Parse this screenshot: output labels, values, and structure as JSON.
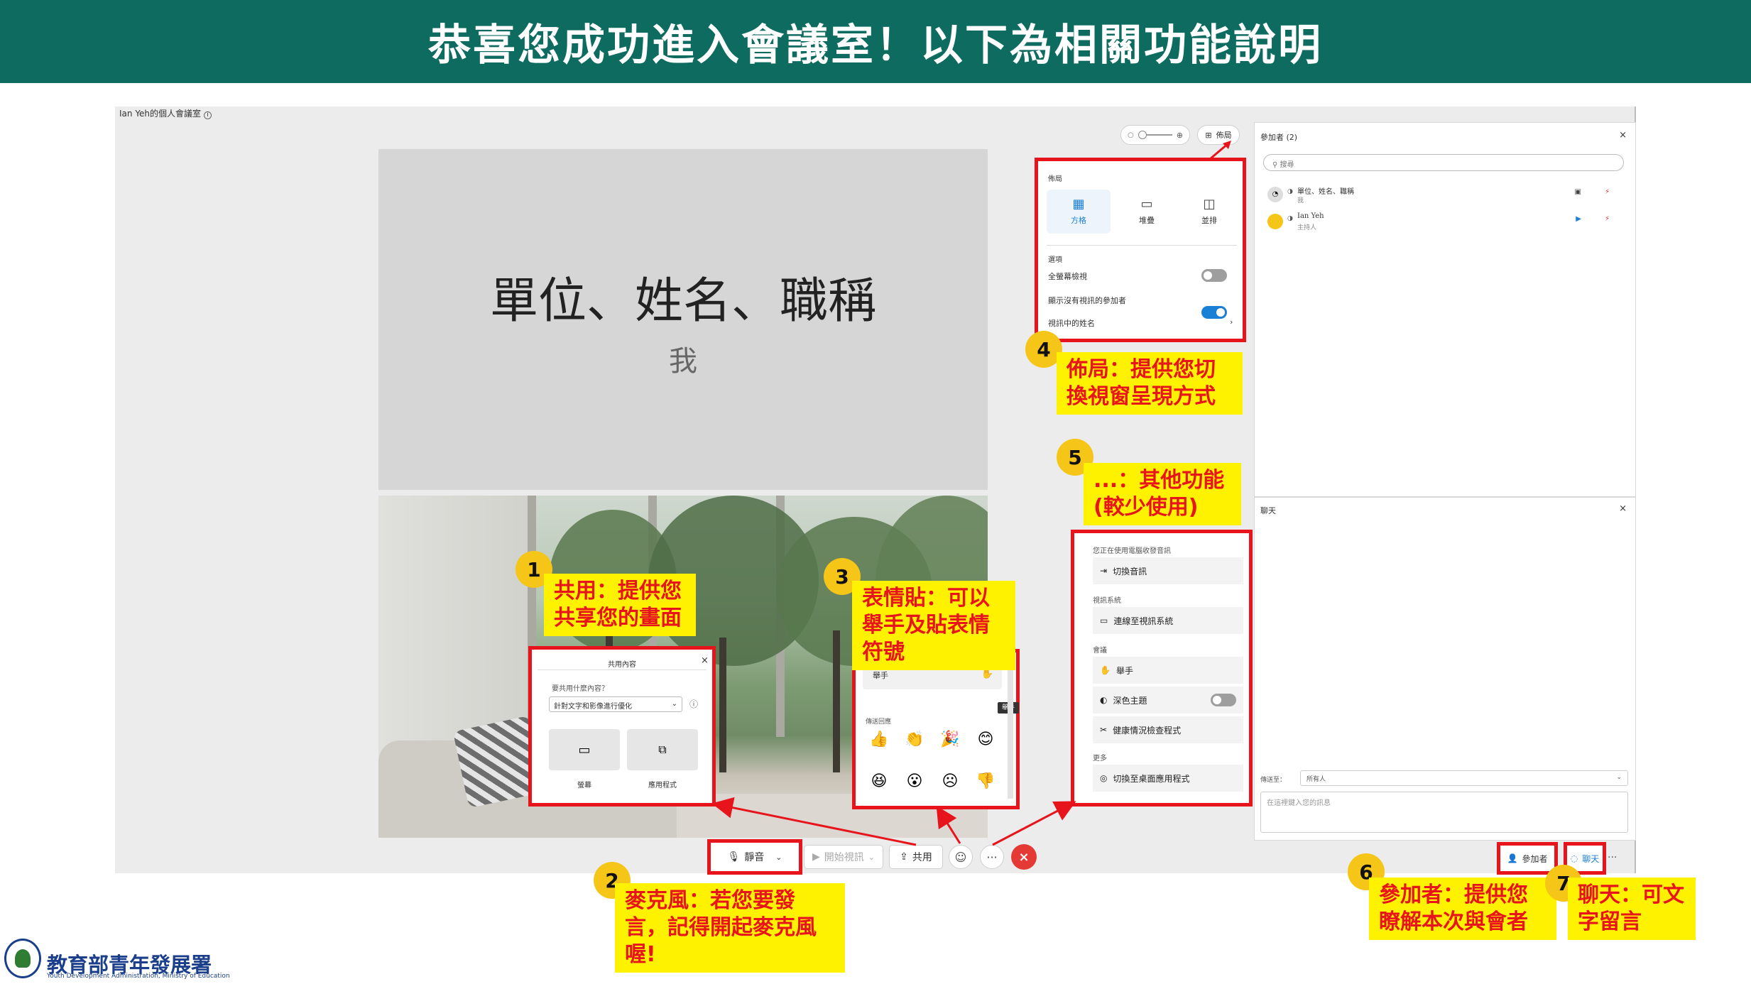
{
  "colors": {
    "header_bg": "#0d6b5f",
    "highlight_red": "#e8141c",
    "callout_yellow": "#fff200",
    "badge_gold": "#f5c518",
    "toggle_blue": "#1a7fd6",
    "leave_red": "#e53935"
  },
  "header": {
    "title": "恭喜您成功進入會議室！以下為相關功能說明"
  },
  "meeting": {
    "room_title": "Ian Yeh的個人會議室",
    "tile": {
      "name": "單位、姓名、職稱",
      "sub": "我"
    },
    "toolbar": {
      "mute": "靜音",
      "video": "開始視訊",
      "share": "共用",
      "more": "···",
      "react_icon": "smile-icon",
      "end_icon": "close-icon"
    },
    "view_controls": {
      "layout": "佈局",
      "zoom_min_icon": "minus-icon",
      "zoom_max_icon": "plus-icon"
    }
  },
  "layout_menu": {
    "title": "佈局",
    "options": [
      {
        "label": "方格",
        "icon": "grid-icon",
        "selected": true
      },
      {
        "label": "堆疊",
        "icon": "stack-icon",
        "selected": false
      },
      {
        "label": "並排",
        "icon": "side-by-side-icon",
        "selected": false
      }
    ],
    "section": "選項",
    "settings": [
      {
        "label": "全螢幕檢視",
        "on": false
      },
      {
        "label": "顯示沒有視訊的參加者",
        "on": true
      }
    ],
    "names_row": "視訊中的姓名"
  },
  "share_popup": {
    "title": "共用內容",
    "question": "要共用什麼內容？",
    "select_value": "針對文字和影像進行優化",
    "screen": "螢幕",
    "app": "應用程式"
  },
  "reactions": {
    "raise_hand": "舉手",
    "tooltip": "舉手",
    "section": "傳送回應",
    "emoji": [
      "👍",
      "👏",
      "🎉",
      "😊",
      "😆",
      "😮",
      "☹",
      "👎"
    ]
  },
  "more_menu": {
    "groups": [
      {
        "label": "您正在使用電腦收發音訊",
        "items": [
          {
            "label": "切換音訊",
            "icon": "audio-switch-icon"
          }
        ]
      },
      {
        "label": "視訊系統",
        "items": [
          {
            "label": "連線至視訊系統",
            "icon": "video-system-icon"
          }
        ]
      },
      {
        "label": "會議",
        "items": [
          {
            "label": "舉手",
            "icon": "hand-icon"
          },
          {
            "label": "深色主題",
            "icon": "theme-icon",
            "toggle": true
          }
        ]
      },
      {
        "label": "",
        "items": [
          {
            "label": "健康情況檢查程式",
            "icon": "tools-icon"
          }
        ]
      },
      {
        "label": "更多",
        "items": [
          {
            "label": "切換至桌面應用程式",
            "icon": "desktop-app-icon"
          }
        ]
      }
    ]
  },
  "participants": {
    "title": "參加者 (2)",
    "search_placeholder": "搜尋",
    "list": [
      {
        "name": "單位、姓名、職稱",
        "role": "我"
      },
      {
        "name": "Ian Yeh",
        "role": "主持人"
      }
    ]
  },
  "chat": {
    "title": "聊天",
    "to_label": "傳送至：",
    "to_value": "所有人",
    "input_placeholder": "在這裡鍵入您的訊息"
  },
  "bottom_right": {
    "participants_btn": "參加者",
    "chat_btn": "聊天",
    "more": "···"
  },
  "callouts": [
    {
      "num": "1",
      "text": "共用：提供您共享您的畫面"
    },
    {
      "num": "2",
      "text": "麥克風：若您要發言，記得開起麥克風喔!"
    },
    {
      "num": "3",
      "text": "表情貼：可以舉手及貼表情符號"
    },
    {
      "num": "4",
      "text": "佈局：提供您切換視窗呈現方式"
    },
    {
      "num": "5",
      "text": "...：其他功能(較少使用)"
    },
    {
      "num": "6",
      "text": "參加者：提供您瞭解本次與會者"
    },
    {
      "num": "7",
      "text": "聊天：可文字留言"
    }
  ],
  "logo": {
    "name": "教育部青年發展署",
    "english": "Youth Development Administration, Ministry of Education"
  }
}
